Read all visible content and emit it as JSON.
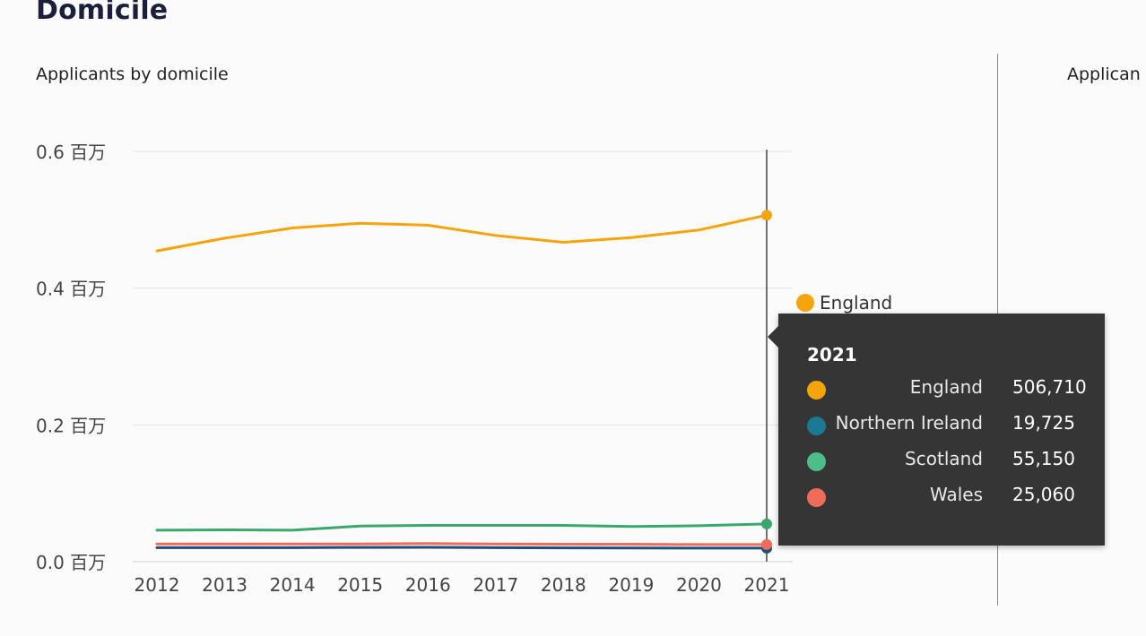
{
  "page": {
    "title": "Domicile",
    "right_panel_title": "Applican"
  },
  "chart_data": {
    "type": "line",
    "title": "Applicants by domicile",
    "xlabel": "",
    "ylabel": "",
    "categories": [
      "2012",
      "2013",
      "2014",
      "2015",
      "2016",
      "2017",
      "2018",
      "2019",
      "2020",
      "2021"
    ],
    "ylim": [
      0,
      0.6
    ],
    "yticks": [
      {
        "value": 0.0,
        "label": "0.0 百万"
      },
      {
        "value": 0.2,
        "label": "0.2 百万"
      },
      {
        "value": 0.4,
        "label": "0.4 百万"
      },
      {
        "value": 0.6,
        "label": "0.6 百万"
      }
    ],
    "grid": true,
    "series": [
      {
        "name": "England",
        "color": "#f5a40c",
        "values": [
          454500,
          473000,
          488000,
          495000,
          492000,
          477000,
          467000,
          474000,
          485000,
          506710
        ]
      },
      {
        "name": "Northern Ireland",
        "color": "#1f4e79",
        "values": [
          20500,
          20500,
          20500,
          20800,
          21000,
          20500,
          20200,
          20000,
          19800,
          19725
        ]
      },
      {
        "name": "Scotland",
        "color": "#3aa86b",
        "values": [
          46000,
          46500,
          46000,
          52000,
          53000,
          53000,
          53000,
          51500,
          52500,
          55150
        ]
      },
      {
        "name": "Wales",
        "color": "#f06c5a",
        "values": [
          26000,
          26000,
          26000,
          26000,
          26500,
          26000,
          25500,
          25500,
          25000,
          25060
        ]
      }
    ],
    "legend": {
      "visible_item": "England",
      "placement": "right"
    },
    "hover": {
      "category": "2021"
    }
  },
  "tooltip": {
    "title": "2021",
    "rows": [
      {
        "label": "England",
        "value": "506,710",
        "color": "#f5a40c"
      },
      {
        "label": "Northern Ireland",
        "value": "19,725",
        "color": "#1a7a96"
      },
      {
        "label": "Scotland",
        "value": "55,150",
        "color": "#4dbd8a"
      },
      {
        "label": "Wales",
        "value": "25,060",
        "color": "#f06c5a"
      }
    ]
  }
}
